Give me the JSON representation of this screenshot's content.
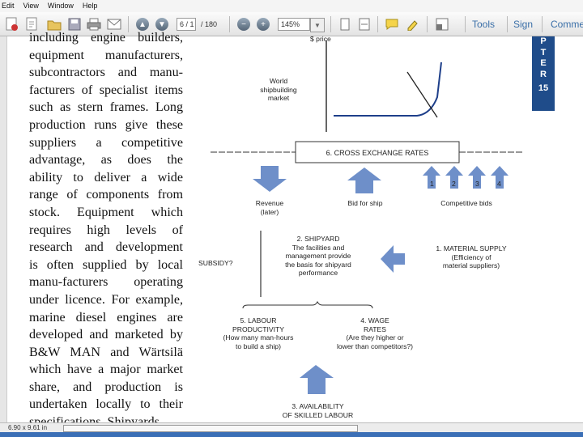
{
  "menu": [
    "Edit",
    "View",
    "Window",
    "Help"
  ],
  "toolbar": {
    "page_current": "6 / 1",
    "page_total": "/ 180",
    "zoom": "145%",
    "tools": "Tools",
    "sign": "Sign",
    "comment": "Comme"
  },
  "sidebar_tab": [
    "P",
    "T",
    "E",
    "R",
    "15"
  ],
  "body_lines": [
    "including engine builders,",
    "equipment manufacturers,",
    "subcontractors and manu-",
    "facturers of specialist items",
    "such as stern frames. Long",
    "production runs give these",
    "suppliers a competitive",
    "advantage, as does the",
    "ability to deliver a wide",
    "range of components from",
    "stock. Equipment which",
    "requires high levels of",
    "research and development",
    "is often supplied by local",
    "manu-facturers operating",
    "under licence. For example,",
    "marine diesel engines are",
    "developed and marketed by",
    "B&W MAN and Wärtsilä",
    "which have a major market",
    "share, and production is",
    "undertaken locally to their",
    "specifications. Shipyards"
  ],
  "diagram": {
    "axis_label": "$ price",
    "market": [
      "World",
      "shipbuilding",
      "market"
    ],
    "exchange": "6. CROSS EXCHANGE RATES",
    "bid_numbers": [
      "1",
      "2",
      "3",
      "4"
    ],
    "revenue": [
      "Revenue",
      "(later)"
    ],
    "bid": "Bid for ship",
    "competitive": "Competitive bids",
    "shipyard": [
      "2. SHIPYARD",
      "The facilities and",
      "management provide",
      "the basis for shipyard",
      "performance"
    ],
    "material": [
      "1. MATERIAL SUPPLY",
      "(Efficiency of",
      "material suppliers)"
    ],
    "subsidy": "SUBSIDY?",
    "labour": [
      "5. LABOUR",
      "PRODUCTIVITY",
      "(How many man-hours",
      "to build a ship)"
    ],
    "wage": [
      "4. WAGE",
      "RATES",
      "(Are they higher or",
      "lower than competitors?)"
    ],
    "skilled": [
      "3. AVAILABILITY",
      "OF SKILLED LABOUR"
    ]
  },
  "status": {
    "page_size": "6.90 x 9.61 in"
  }
}
